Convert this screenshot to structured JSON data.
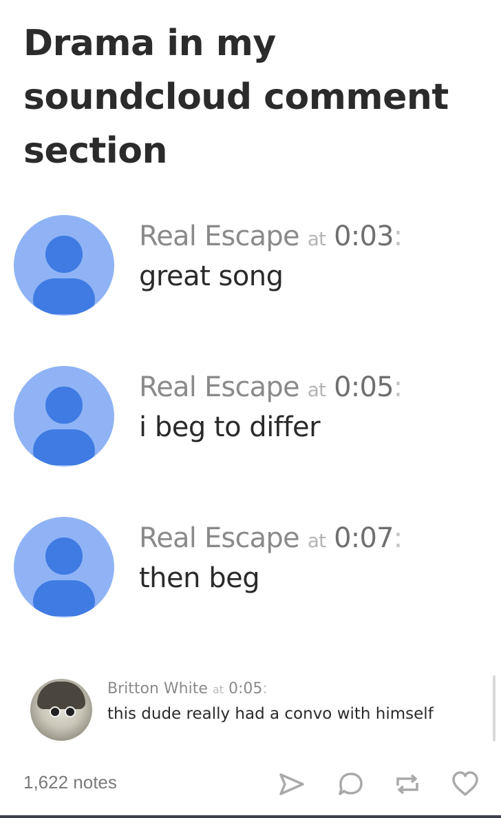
{
  "post": {
    "title": "Drama in my soundcloud comment section",
    "notes_count": "1,622 notes"
  },
  "comments": [
    {
      "author": "Real Escape",
      "at": "at",
      "time": "0:03",
      "colon": ":",
      "text": "great song"
    },
    {
      "author": "Real Escape",
      "at": "at",
      "time": "0:05",
      "colon": ":",
      "text": "i beg to differ"
    },
    {
      "author": "Real Escape",
      "at": "at",
      "time": "0:07",
      "colon": ":",
      "text": "then beg"
    }
  ],
  "reply": {
    "author": "Britton White",
    "at": "at",
    "time": "0:05",
    "colon": ":",
    "text": "this dude really had a convo with himself"
  },
  "actions": {
    "share_icon": "send-icon",
    "reply_icon": "speech-bubble-icon",
    "reblog_icon": "reblog-icon",
    "like_icon": "heart-icon"
  },
  "colors": {
    "avatar_bg": "#8fb3f5",
    "avatar_fg": "#3f7be3",
    "icon": "#a9a9a9"
  }
}
